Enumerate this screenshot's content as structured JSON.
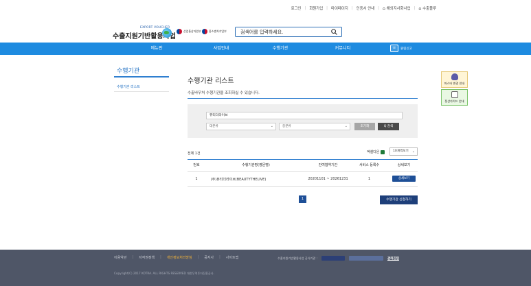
{
  "util": {
    "login": "로그인",
    "join": "회원가입",
    "mypage": "마이페이지",
    "cert_guide": "인증서 안내",
    "overseas": "해외지사화사업",
    "export_voucher": "수출플루"
  },
  "header": {
    "logo_eng": "EXPORT VOUCHER",
    "logo_kor": "수출지원기반활용사업",
    "ministry1": "산업통상자원부",
    "ministry2": "중소벤처기업부",
    "search_placeholder": "검색어를 입력하세요."
  },
  "gnb": {
    "items": [
      "메뉴판",
      "사업안내",
      "수행기관",
      "커뮤니티"
    ],
    "cs_label": "원링신고"
  },
  "lnb": {
    "title": "수행기관",
    "items": [
      "수행기관 리스트"
    ]
  },
  "main": {
    "title": "수행기관 리스트",
    "desc": "수출바우처 수행기관을 조회하실 수 있습니다.",
    "filter": {
      "keyword": "뷰티더라이브",
      "category_major": "대분류",
      "category_mid": "중분류",
      "reset_label": "초기화",
      "search_label": "Q 검색"
    },
    "total": "전체 1건",
    "excel_label": "엑셀다운",
    "per_page": "10개씩보기",
    "columns": [
      "번호",
      "수행기관명(영문명)",
      "잔여협약기간",
      "서비스 등록수",
      "상세보기"
    ],
    "rows": [
      {
        "no": "1",
        "name": "(주)뷰티더라이브(BEAUTYTHELIVE)",
        "period": "20201101 ~ 20261231",
        "services": "1",
        "detail_label": "상세보기"
      }
    ],
    "page": "1",
    "apply_label": "수행기관 신청하기"
  },
  "quick": {
    "q1": "마스터 변경 안내",
    "q2": "정산가이드 안내"
  },
  "footer": {
    "links": [
      "이용약관",
      "저작권정책",
      "개인정보처리방침",
      "공지사",
      "사이트맵"
    ],
    "related_label": "수출지원기반활용사업 공식기관 :",
    "go_label": "관리진입",
    "copyright": "Copyright(C) 2017 KOTRA. ALL RIGHTS RESERVED 대한무역투자진흥공사."
  },
  "colors": {
    "gnb": "#1e8be0",
    "primary": "#1f6fc2",
    "button_dark": "#1e4f97",
    "footer": "#4f5667"
  }
}
